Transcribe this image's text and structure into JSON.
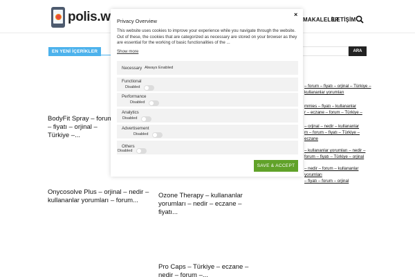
{
  "header": {
    "logo_text": "polis.web.",
    "menu": {
      "makaleler": "MAKALELER",
      "iletisim": "İLETİŞİM"
    }
  },
  "section": {
    "tag": "EN YENİ İÇERİKLER"
  },
  "posts": [
    {
      "title": "BodyFit Spray – forum – fiyatı – orjinal – Türkiye –..."
    },
    {
      "title": "Onycosolve Plus – orjinal – nedir – kullananlar yorumları – forum..."
    },
    {
      "title": "Ozone Therapy – kullananlar yorumları – nedir – eczane – fiyatı..."
    },
    {
      "title": "Pro Caps – Türkiye – eczane – nedir – forum –..."
    }
  ],
  "sidebar": {
    "search_button": "ARA",
    "links": [
      [
        "– forum – fiyatı – orjinal – Türkiye –",
        "kullananlar yorumları"
      ],
      [
        "mmies – fiyatı – kullananlar",
        "r – eczane – forum – Türkiye –"
      ],
      [
        "– orjinal – nedir – kullananlar",
        "m – forum – fiyatı – Türkiye – eczane"
      ],
      [
        "– kullananlar yorumları – nedir –",
        "forum – fiyatı – Türkiye – orjinal"
      ],
      [
        "– nedir – forum – kullananlar yorumları",
        "– fiyatı – forum – orjinal"
      ]
    ]
  },
  "cookie": {
    "title": "Privacy Overview",
    "description": "This website uses cookies to improve your experience while you navigate through the website. Out of these, the cookies that are categorized as necessary are stored on your browser as they are essential for the working of basic functionalities of the ...",
    "show_more": "Show more",
    "close": "×",
    "categories": {
      "necessary": {
        "label": "Necessary",
        "status": "Always Enabled"
      },
      "functional": {
        "label": "Functional",
        "status": "Disabled"
      },
      "performance": {
        "label": "Performance",
        "status": "Disabled"
      },
      "analytics": {
        "label": "Analytics",
        "status": "Disabled"
      },
      "advertisement": {
        "label": "Advertisement",
        "status": "Disabled"
      },
      "others": {
        "label": "Others",
        "status": "Disabled"
      }
    },
    "accept_button": "SAVE & ACCEPT"
  },
  "colors": {
    "accent": "#4db2ec",
    "accept_green": "#61a229",
    "panel_row": "#f2f2f2"
  }
}
